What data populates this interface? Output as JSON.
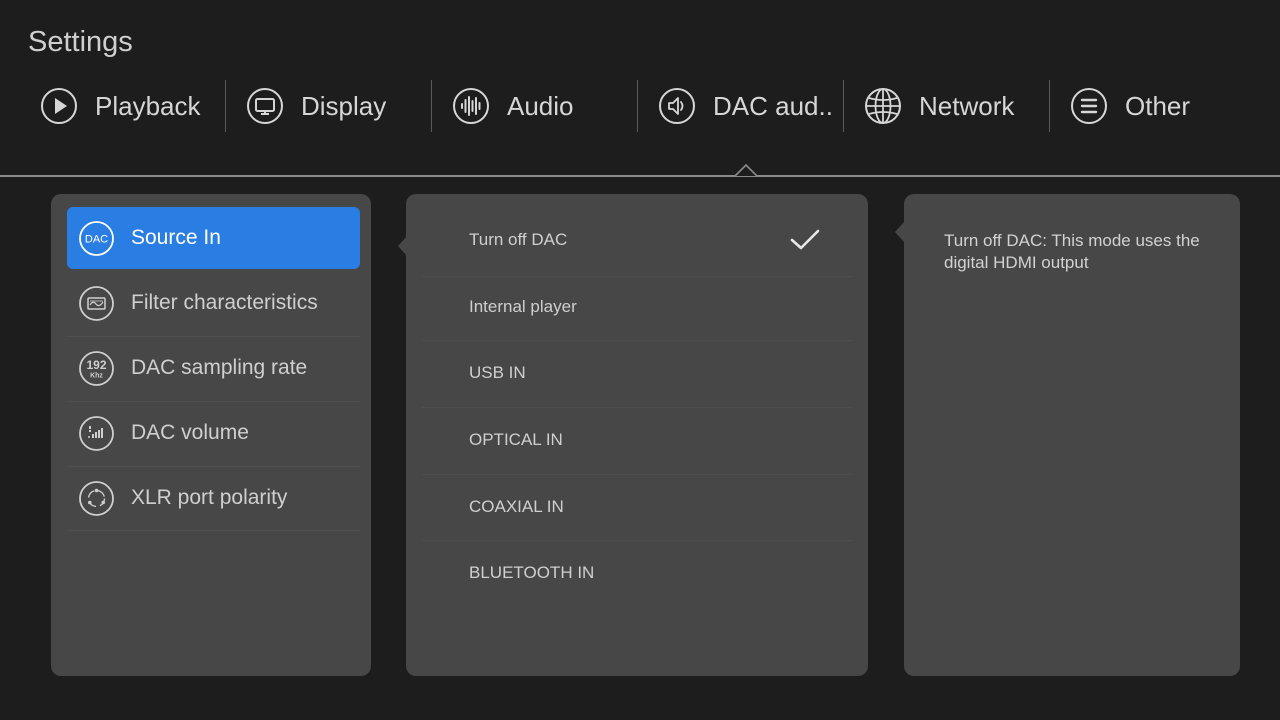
{
  "header": {
    "title": "Settings"
  },
  "tabs": [
    {
      "label": "Playback",
      "icon": "play-circle-icon"
    },
    {
      "label": "Display",
      "icon": "monitor-icon"
    },
    {
      "label": "Audio",
      "icon": "audio-wave-icon"
    },
    {
      "label": "DAC aud..",
      "icon": "speaker-icon",
      "selected": true
    },
    {
      "label": "Network",
      "icon": "globe-icon"
    },
    {
      "label": "Other",
      "icon": "menu-lines-icon"
    }
  ],
  "menu": {
    "items": [
      {
        "label": "Source In",
        "icon": "dac-icon",
        "icon_text": "DAC",
        "active": true
      },
      {
        "label": "Filter characteristics",
        "icon": "filter-icon"
      },
      {
        "label": "DAC sampling rate",
        "icon": "sampling-rate-icon",
        "icon_text": "192",
        "icon_subtext": "Khz"
      },
      {
        "label": "DAC volume",
        "icon": "volume-bars-icon"
      },
      {
        "label": "XLR port polarity",
        "icon": "xlr-port-icon"
      }
    ]
  },
  "options": {
    "items": [
      {
        "label": "Turn off DAC",
        "checked": true
      },
      {
        "label": "Internal player",
        "checked": false
      },
      {
        "label": "USB IN",
        "checked": false
      },
      {
        "label": "OPTICAL IN",
        "checked": false
      },
      {
        "label": "COAXIAL IN",
        "checked": false
      },
      {
        "label": "BLUETOOTH IN",
        "checked": false
      }
    ]
  },
  "description": {
    "text": "Turn off DAC: This mode uses the digital HDMI output"
  },
  "colors": {
    "background": "#1d1d1d",
    "panel": "#474747",
    "accent": "#2a7ee3",
    "text": "#d6d6d6"
  }
}
